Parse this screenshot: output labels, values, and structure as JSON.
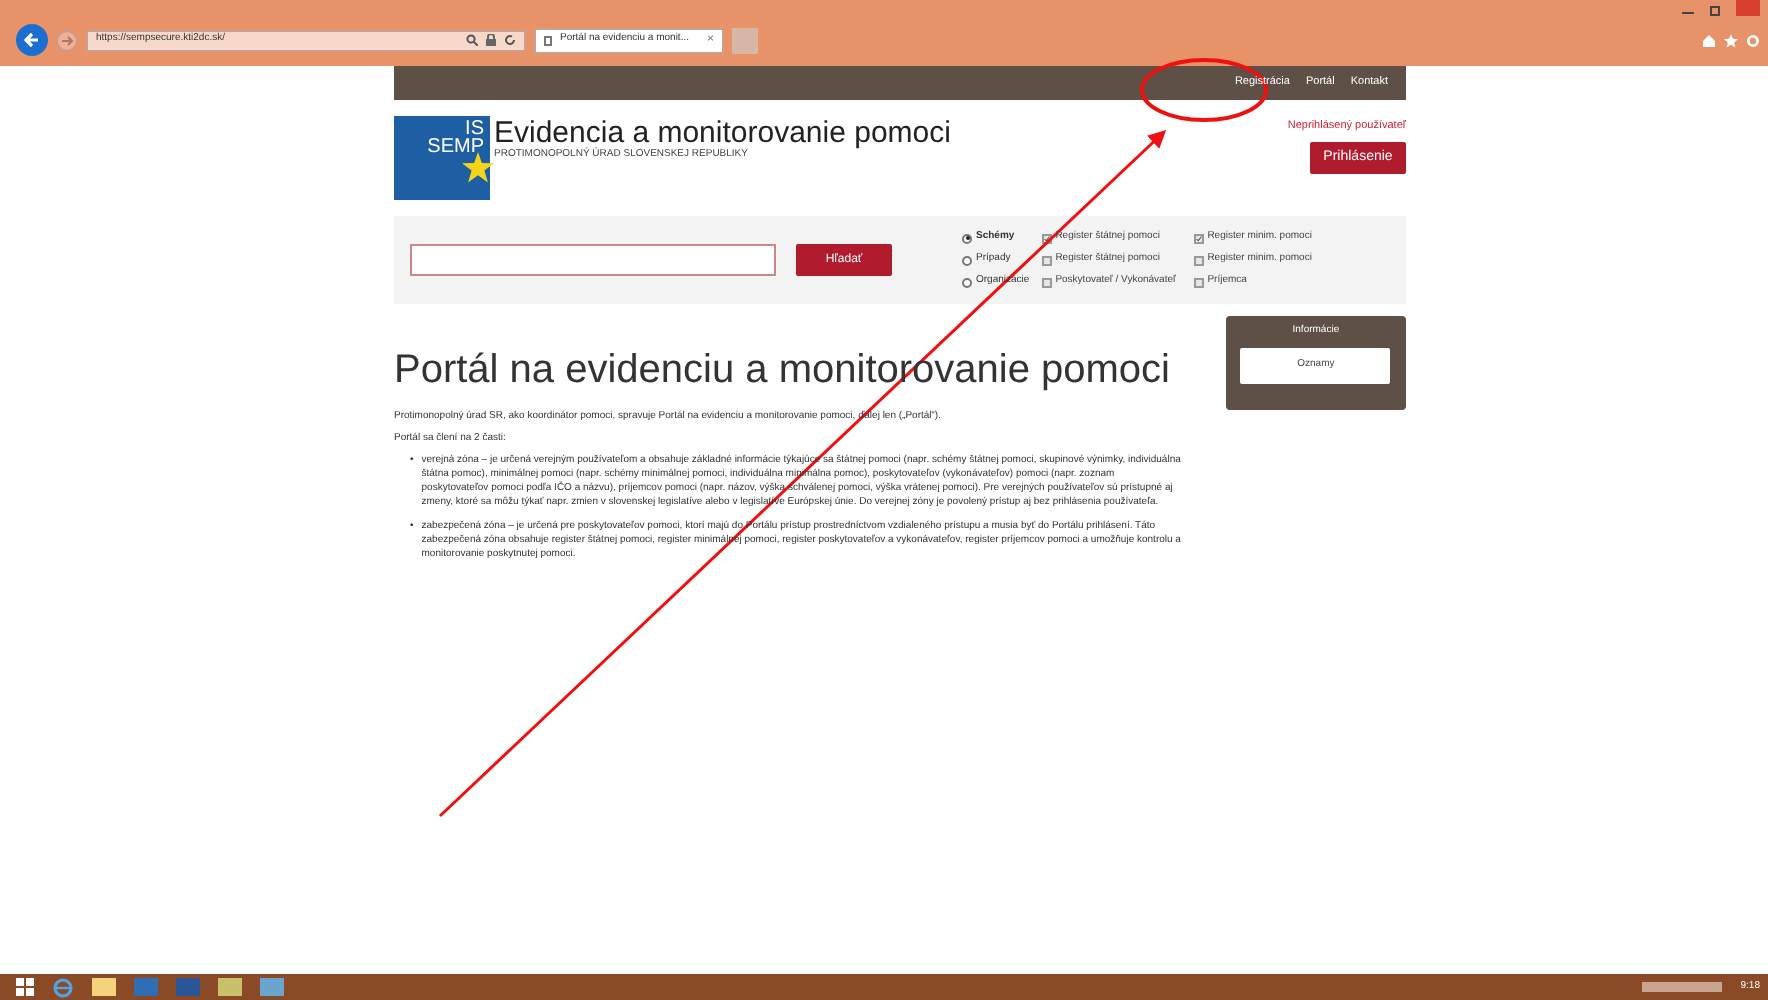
{
  "browser": {
    "address": "https://sempsecure.kti2dc.sk/",
    "tab": "Portál na evidenciu a monit...",
    "tab_close": "×"
  },
  "top_nav": [
    "Registrácia",
    "Portál",
    "Kontakt"
  ],
  "header": {
    "logo_line1": "IS",
    "logo_line2": "SEMP",
    "title": "Evidencia a monitorovanie pomoci",
    "subtitle": "PROTIMONOPOLNÝ ÚRAD SLOVENSKEJ REPUBLIKY",
    "user_status": "Neprihlásený používateľ",
    "login_button": "Prihlásenie"
  },
  "search": {
    "button": "Hľadať",
    "radios": [
      {
        "label": "Schémy",
        "selected": true
      },
      {
        "label": "Prípady",
        "selected": false
      },
      {
        "label": "Organizácie",
        "selected": false
      }
    ],
    "checkbox_rows": [
      [
        {
          "label": "Register štátnej pomoci",
          "checked": true
        },
        {
          "label": "Register minim. pomoci",
          "checked": true
        }
      ],
      [
        {
          "label": "Register štátnej pomoci",
          "checked": false
        },
        {
          "label": "Register minim. pomoci",
          "checked": false
        }
      ],
      [
        {
          "label": "Poskytovateľ / Vykonávateľ",
          "checked": false
        },
        {
          "label": "Príjemca",
          "checked": false
        }
      ]
    ]
  },
  "info_box": {
    "title": "Informácie",
    "button": "Oznamy"
  },
  "main": {
    "heading": "Portál na evidenciu a monitorovanie pomoci",
    "intro": "Protimonopolný úrad SR, ako koordinátor pomoci, spravuje Portál na evidenciu a monitorovanie pomoci, ďalej len („Portál“).",
    "parts": "Portál sa člení na 2 časti:",
    "bullets": [
      {
        "marker": "•",
        "text": "verejná zóna – je určená verejným používateľom a obsahuje základné informácie týkajúce sa štátnej pomoci (napr. schémy štátnej pomoci, skupinové výnimky, individuálna štátna pomoc), minimálnej pomoci (napr. schémy minimálnej pomoci, individuálna minimálna pomoc), poskytovateľov (vykonávateľov) pomoci (napr. zoznam poskytovateľov pomoci podľa IČO a názvu), príjemcov pomoci (napr. názov, výška schválenej pomoci, výška vrátenej pomoci). Pre verejných používateľov sú prístupné aj zmeny, ktoré sa môžu týkať napr. zmien v slovenskej legislatíve alebo v legislatíve Európskej únie. Do verejnej zóny je povolený prístup aj bez prihlásenia používateľa."
      },
      {
        "marker": "•",
        "text": "zabezpečená zóna – je určená pre poskytovateľov pomoci, ktorí majú do Portálu prístup prostredníctvom vzdialeného prístupu a musia byť do Portálu prihlásení. Táto zabezpečená zóna obsahuje register štátnej pomoci, register minimálnej pomoci, register poskytovateľov a vykonávateľov, register príjemcov pomoci a umožňuje kontrolu a monitorovanie poskytnutej pomoci."
      }
    ]
  },
  "taskbar": {
    "clock": "9:18"
  }
}
